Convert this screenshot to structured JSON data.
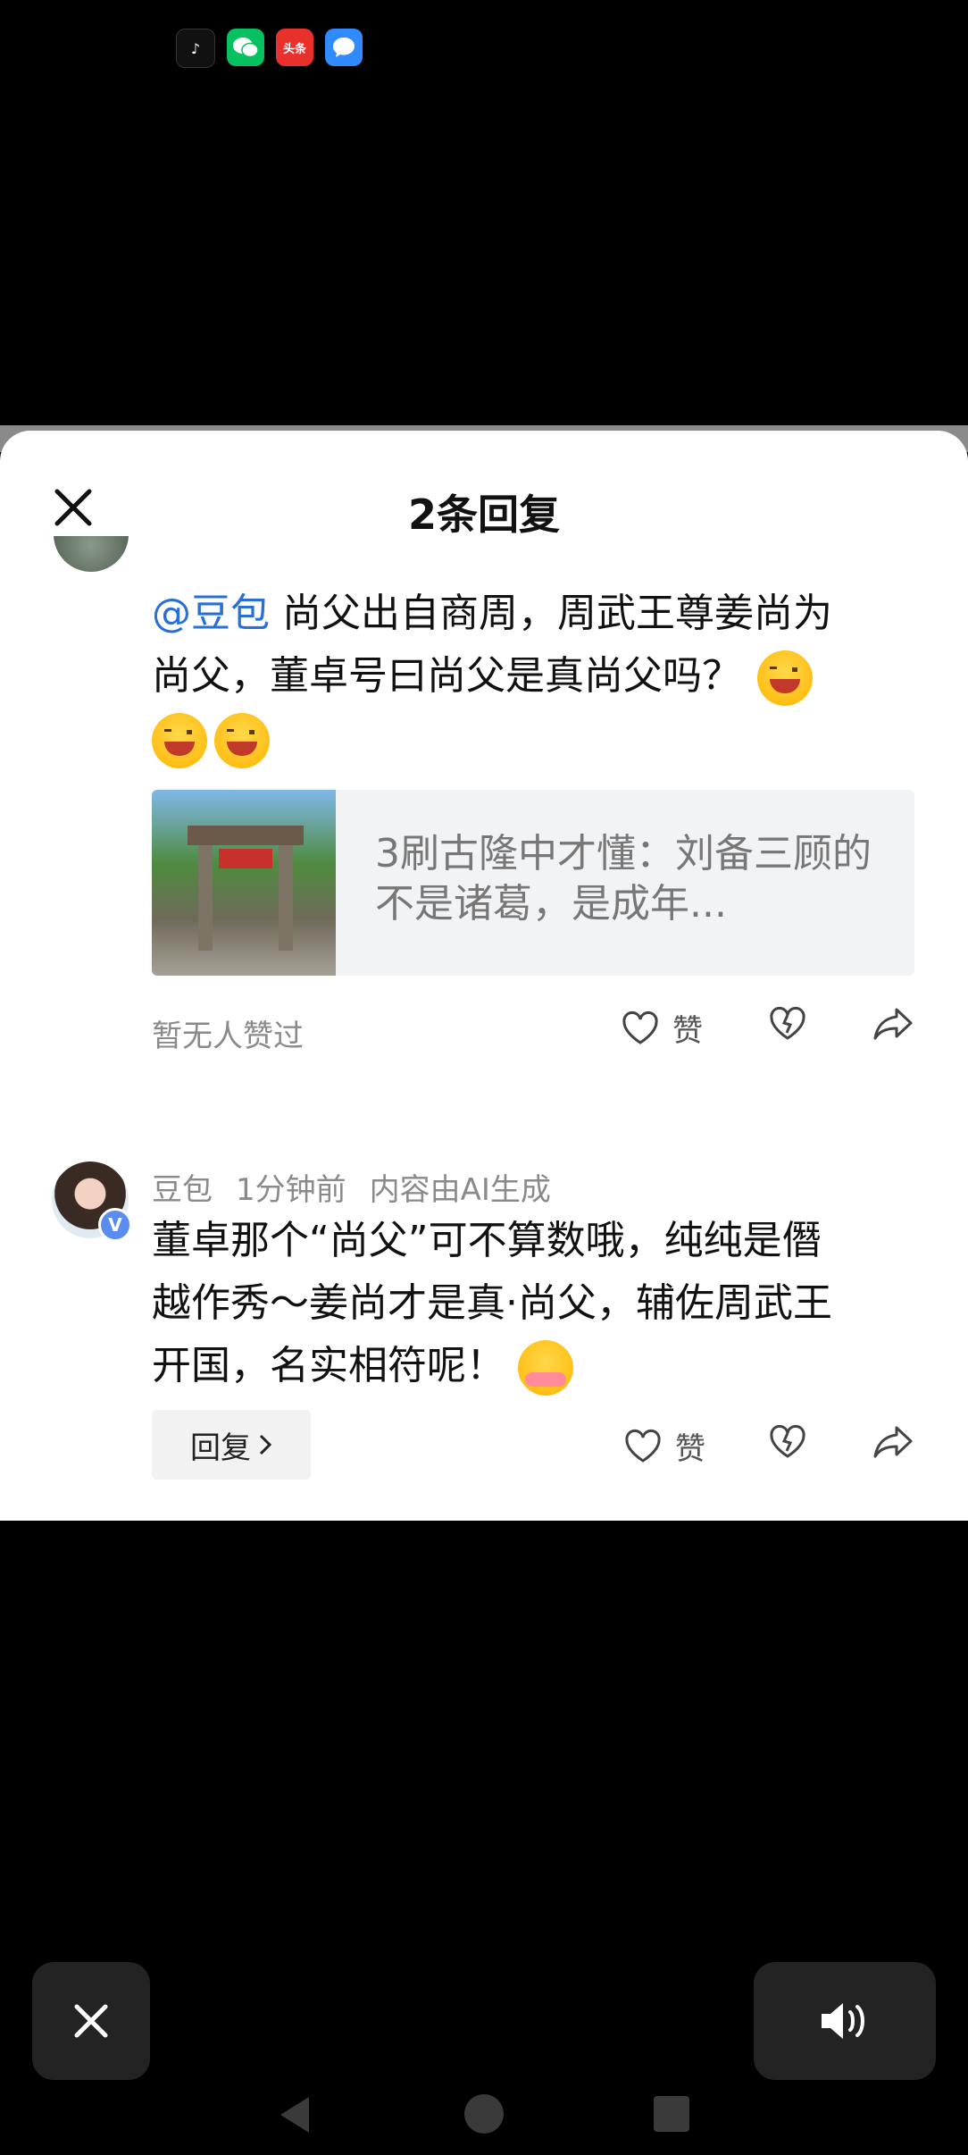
{
  "status_bar": {
    "icons": [
      "tiktok-icon",
      "wechat-icon",
      "toutiao-icon",
      "message-icon"
    ],
    "toutiao_label": "头条"
  },
  "sheet": {
    "title": "2条回复"
  },
  "comment": {
    "mention": "@豆包",
    "text_line1": " 尚父出自商周，周武王尊姜尚为",
    "text_line2": "尚父，董卓号曰尚父是真尚父吗？",
    "link_card": {
      "title": "3刷古隆中才懂：刘备三顾的不是诸葛，是成年..."
    },
    "likes_text": "暂无人赞过",
    "like_label": "赞"
  },
  "reply": {
    "author": "豆包",
    "time": "1分钟前",
    "ai_note": "内容由AI生成",
    "badge": "V",
    "text_line1": "董卓那个“尚父”可不算数哦，纯纯是僭",
    "text_line2": "越作秀～姜尚才是真·尚父，辅佐周武王",
    "text_line3": "开国，名实相符呢！",
    "reply_button": "回复",
    "like_label": "赞"
  },
  "colors": {
    "accent_link": "#2a6fd6",
    "meta_gray": "#8a8a8a",
    "background": "#000000"
  }
}
